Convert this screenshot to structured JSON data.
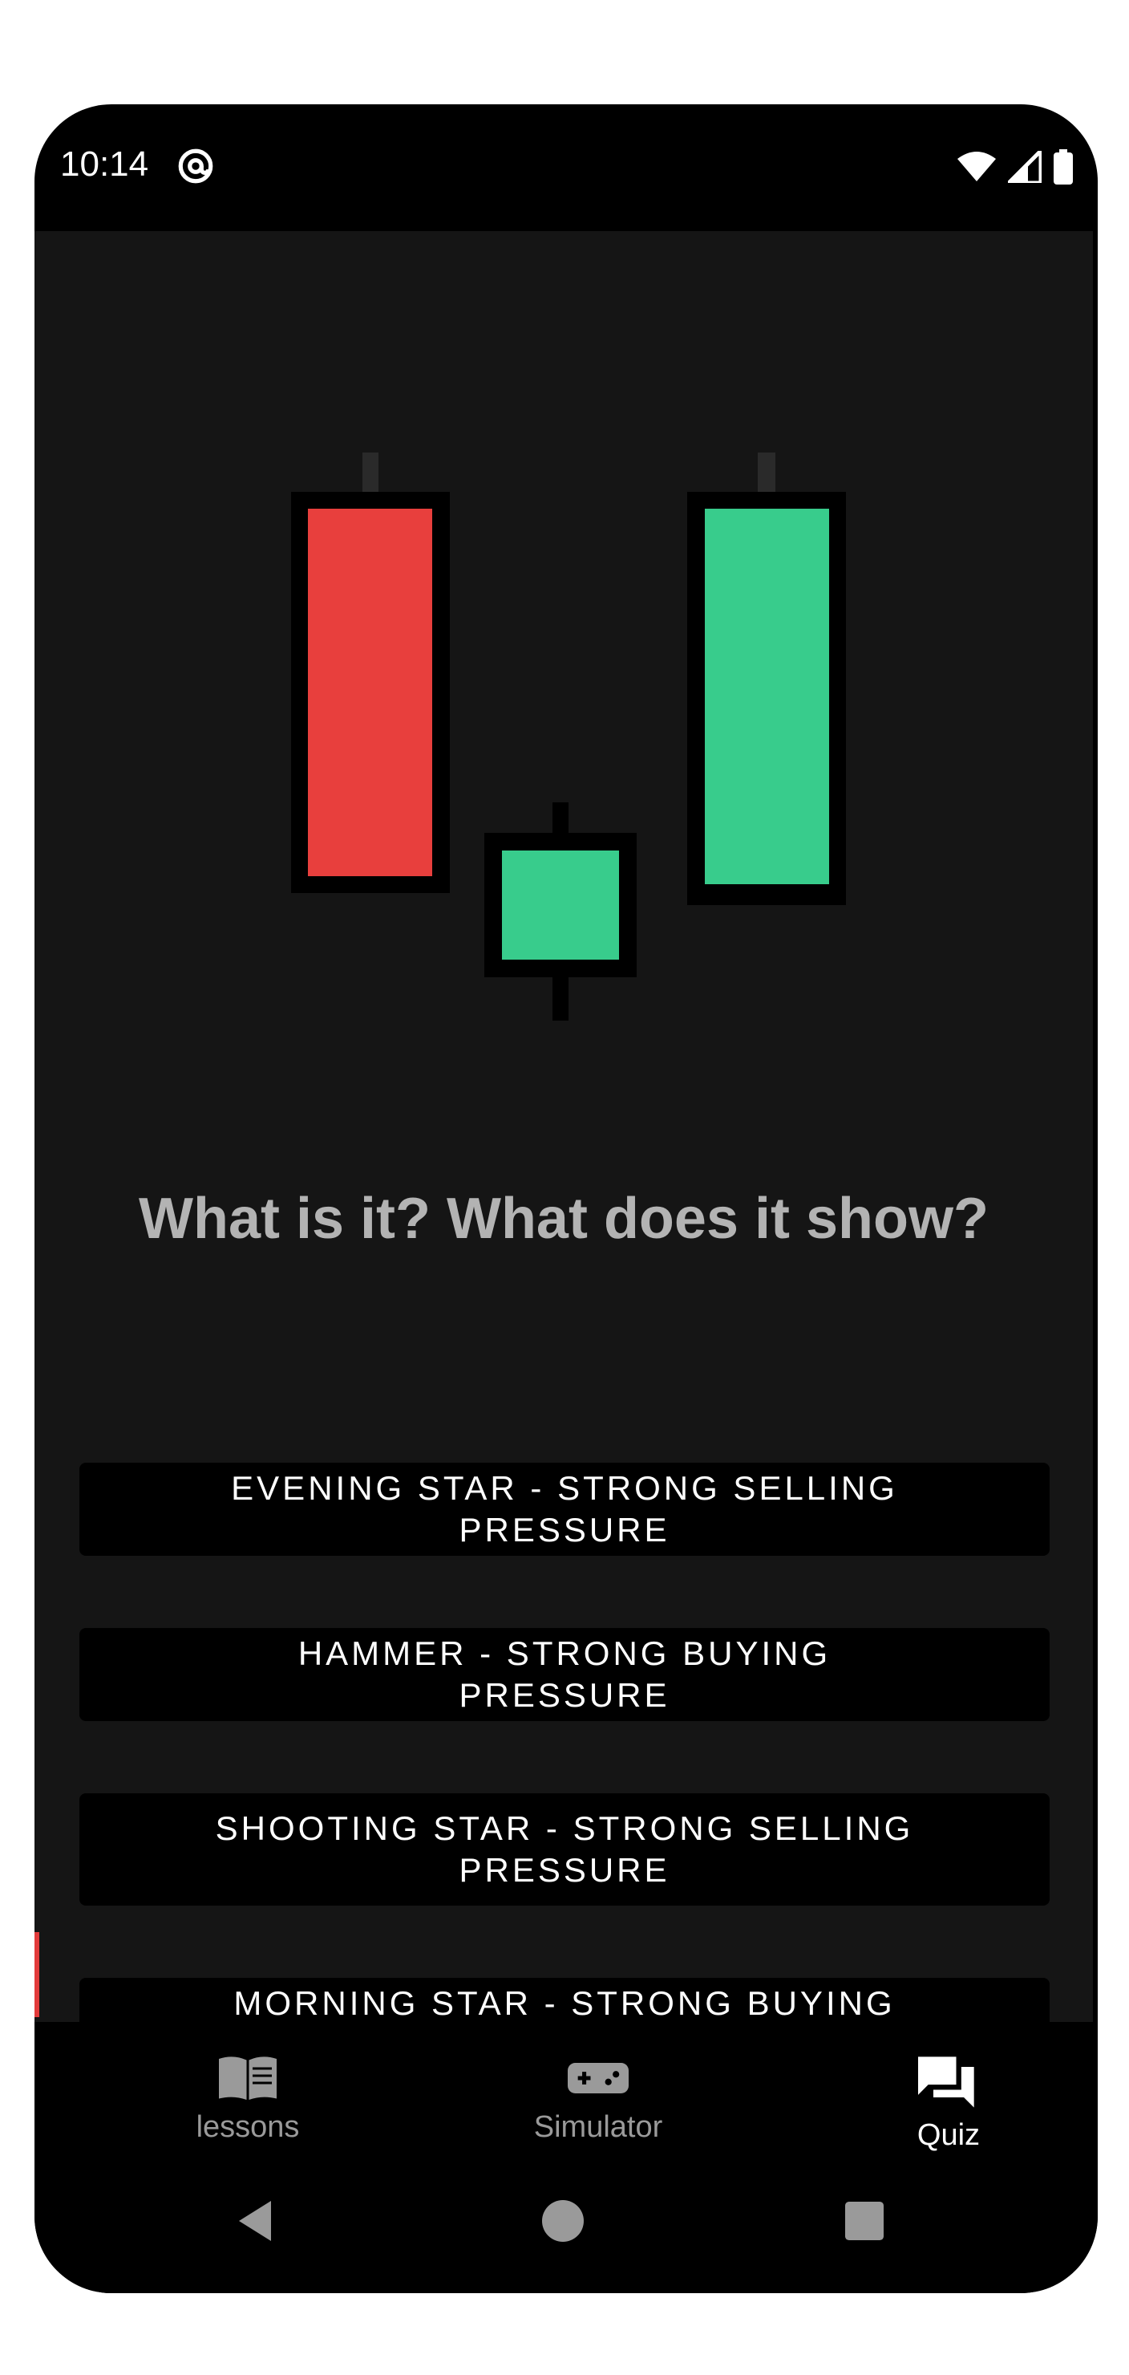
{
  "status_bar": {
    "time": "10:14",
    "app_icon": "at-sign-icon",
    "icons": [
      "wifi-icon",
      "signal-icon",
      "battery-icon"
    ]
  },
  "quiz": {
    "question": "What is it? What does it show?",
    "candles": [
      {
        "direction": "bearing",
        "color": "#e83f3d"
      },
      {
        "direction": "bullish",
        "color": "#38cc8c"
      },
      {
        "direction": "bullish",
        "color": "#38cc8c"
      }
    ],
    "answers": [
      "EVENING STAR - STRONG SELLING PRESSURE",
      "HAMMER - STRONG BUYING PRESSURE",
      "SHOOTING STAR - STRONG SELLING PRESSURE",
      "MORNING STAR - STRONG BUYING PRESSURE"
    ]
  },
  "bottom_nav": {
    "items": [
      {
        "label": "lessons",
        "icon": "book-icon",
        "active": false
      },
      {
        "label": "Simulator",
        "icon": "gamepad-icon",
        "active": false
      },
      {
        "label": "Quiz",
        "icon": "chat-icon",
        "active": true
      }
    ]
  },
  "system_nav": [
    "back-icon",
    "home-icon",
    "recents-icon"
  ],
  "colors": {
    "bearish": "#e83f3d",
    "bullish": "#38cc8c",
    "background": "#151515"
  }
}
